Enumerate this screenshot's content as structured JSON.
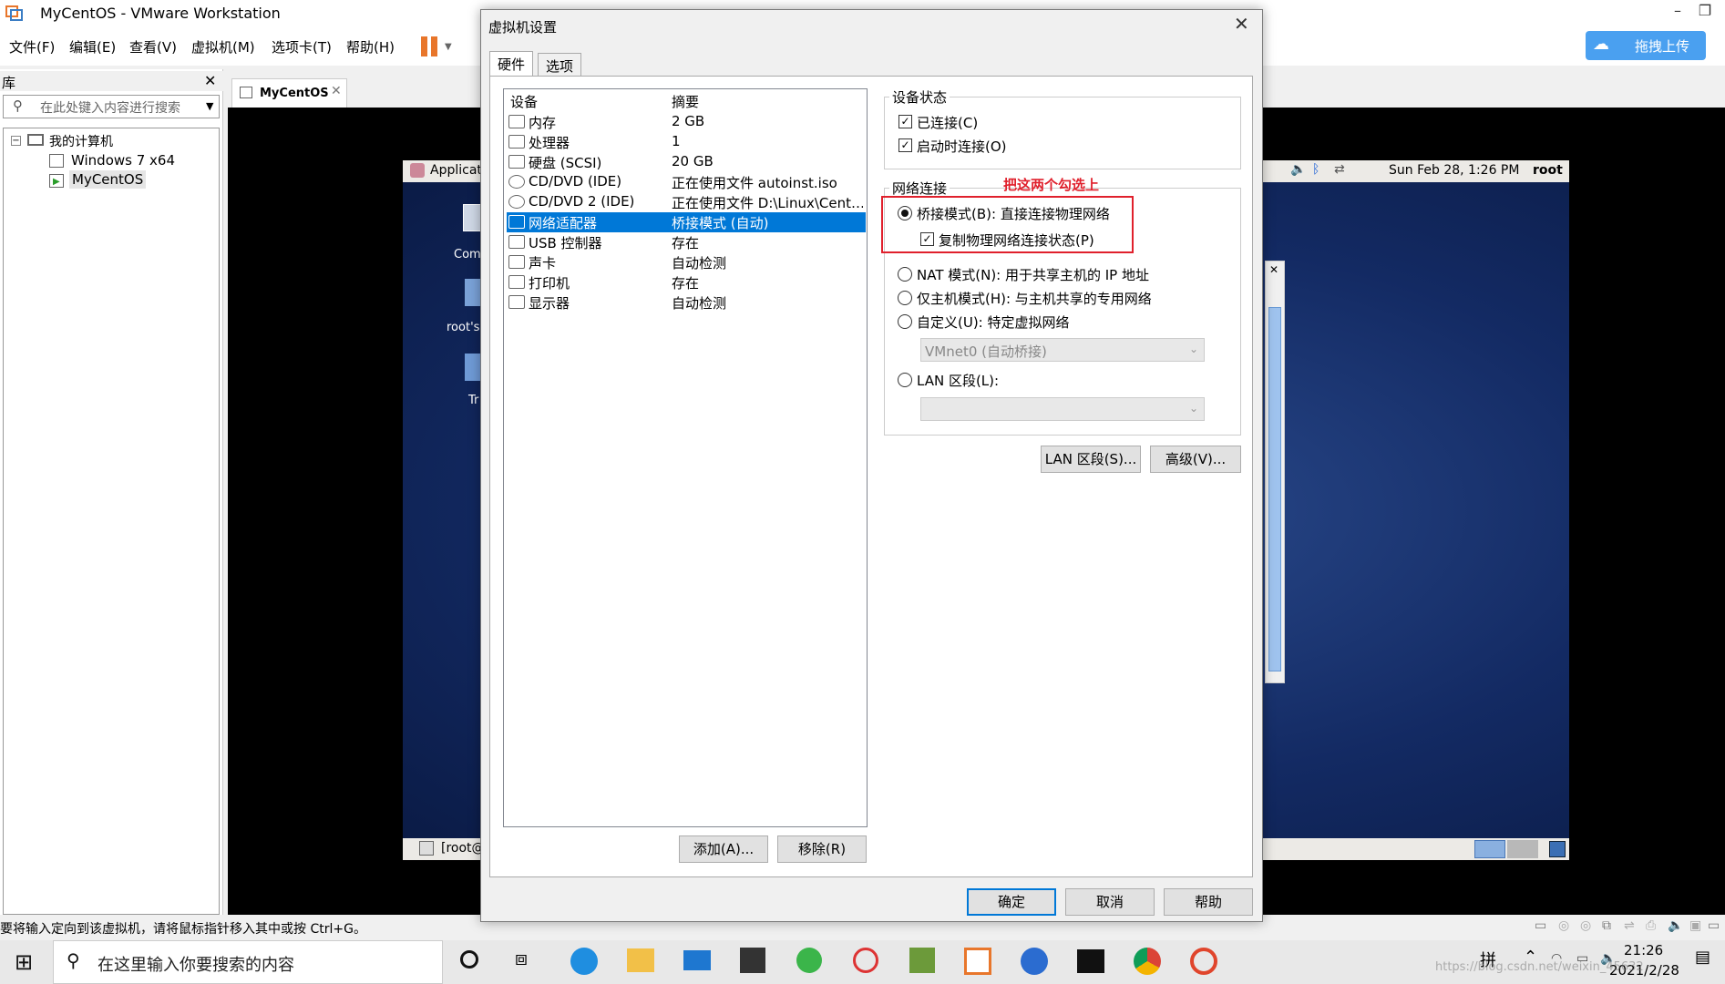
{
  "window": {
    "title": "MyCentOS - VMware Workstation"
  },
  "menubar": {
    "items": [
      "文件(F)",
      "编辑(E)",
      "查看(V)",
      "虚拟机(M)",
      "选项卡(T)",
      "帮助(H)"
    ],
    "upload_label": "拖拽上传"
  },
  "library": {
    "title": "库",
    "search_placeholder": "在此处键入内容进行搜索",
    "tree": {
      "root": "我的计算机",
      "vms": [
        "Windows 7 x64",
        "MyCentOS"
      ]
    }
  },
  "vm_tab": {
    "label": "MyCentOS"
  },
  "guest": {
    "top_menu": "Applicat",
    "clock": "Sun Feb 28,  1:26 PM",
    "user": "root",
    "desktop_icons": [
      "Com",
      "root's",
      "Tr"
    ],
    "taskbar_item": "[root@"
  },
  "dialog": {
    "title": "虚拟机设置",
    "tabs": [
      "硬件",
      "选项"
    ],
    "columns": {
      "device": "设备",
      "summary": "摘要"
    },
    "devices": [
      {
        "name": "内存",
        "summary": "2 GB",
        "icon": "memory-icon"
      },
      {
        "name": "处理器",
        "summary": "1",
        "icon": "cpu-icon"
      },
      {
        "name": "硬盘 (SCSI)",
        "summary": "20 GB",
        "icon": "harddisk-icon"
      },
      {
        "name": "CD/DVD (IDE)",
        "summary": "正在使用文件 autoinst.iso",
        "icon": "cdrom-icon"
      },
      {
        "name": "CD/DVD 2 (IDE)",
        "summary": "正在使用文件 D:\\Linux\\Cent…",
        "icon": "cdrom-icon"
      },
      {
        "name": "网络适配器",
        "summary": "桥接模式 (自动)",
        "icon": "network-icon"
      },
      {
        "name": "USB 控制器",
        "summary": "存在",
        "icon": "usb-icon"
      },
      {
        "name": "声卡",
        "summary": "自动检测",
        "icon": "sound-icon"
      },
      {
        "name": "打印机",
        "summary": "存在",
        "icon": "printer-icon"
      },
      {
        "name": "显示器",
        "summary": "自动检测",
        "icon": "display-icon"
      }
    ],
    "selected_device_index": 5,
    "add_button": "添加(A)...",
    "remove_button": "移除(R)",
    "device_status": {
      "label": "设备状态",
      "connected": "已连接(C)",
      "connect_at_power_on": "启动时连接(O)"
    },
    "network": {
      "label": "网络连接",
      "annotation": "把这两个勾选上",
      "bridged": "桥接模式(B): 直接连接物理网络",
      "replicate": "复制物理网络连接状态(P)",
      "nat": "NAT 模式(N): 用于共享主机的 IP 地址",
      "host_only": "仅主机模式(H): 与主机共享的专用网络",
      "custom": "自定义(U): 特定虚拟网络",
      "custom_value": "VMnet0 (自动桥接)",
      "lan": "LAN 区段(L):",
      "lan_value": ""
    },
    "lan_segments_button": "LAN 区段(S)...",
    "advanced_button": "高级(V)...",
    "ok_button": "确定",
    "cancel_button": "取消",
    "help_button": "帮助"
  },
  "statusbar": {
    "message": "要将输入定向到该虚拟机，请将鼠标指针移入其中或按 Ctrl+G。"
  },
  "taskbar": {
    "search_placeholder": "在这里输入你要搜索的内容",
    "time": "21:26",
    "date": "2021/2/28",
    "watermark": "https://blog.csdn.net/weixin_45632"
  },
  "colors": {
    "accent": "#0078d7",
    "annotation": "#e0202c",
    "pause": "#e8762b"
  }
}
